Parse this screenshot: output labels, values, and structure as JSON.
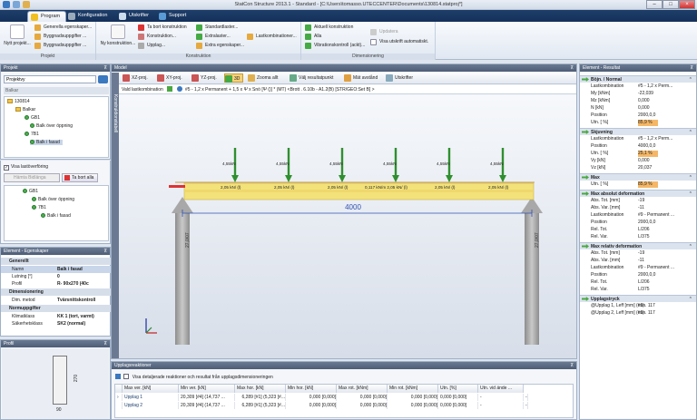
{
  "window": {
    "title": "StatCon Structure 2013.1 - Standard - [C:\\Users\\tomasso.UTECCENTER\\Documents\\130814.statproj*]"
  },
  "tabs": [
    {
      "label": "Program"
    },
    {
      "label": "Konfiguration"
    },
    {
      "label": "Utskrifter"
    },
    {
      "label": "Support"
    }
  ],
  "ribbon": {
    "projekt_group": "Projekt",
    "new_project": "Nytt projekt...",
    "gen_props": "Generella egenskaper...",
    "building_props": "Byggnadsuppgifter ...",
    "building_props2": "Byggnadsuppgifter ...",
    "new_construction": "Ny konstruktion...",
    "delete_construction": "Ta bort konstruktion",
    "construction": "Konstruktion...",
    "supports": "Upplag...",
    "standard_sizes": "Standardlaster...",
    "extra_loads": "Extralaster...",
    "extra_props": "Extra egenskaper...",
    "load_combinations": "Lastkombinationer...",
    "konstruktion_group": "Konstruktion",
    "current_construction": "Aktuell konstruktion",
    "all": "Alla",
    "vibration_check": "Vibrationskontroll (ackt)...",
    "dimensionering_group": "Dimensionering",
    "update": "Updatera",
    "show_print_auto": "Visa utskrift automatiskt."
  },
  "project": {
    "header": "Projekt",
    "view_select": "Projektvy",
    "tree_title": "Balkar",
    "tree": [
      "130814",
      "Balkar",
      "GB1",
      "Balk över öppning",
      "7B1",
      "Balk i fasad"
    ]
  },
  "loadflow": {
    "checkbox_label": "Visa lastöverföring",
    "btn_add": "Hämta Bidlänga",
    "btn_remove": "Ta bort alla",
    "tree": [
      "GB1",
      "Balk över öppning",
      "7B1",
      "Balk i fasad"
    ]
  },
  "element_props": {
    "header": "Element - Egenskaper",
    "sections": {
      "general": "Generellt",
      "dim": "Dimensionering",
      "norm": "Normuppgifter"
    },
    "rows": [
      {
        "k": "Namn",
        "v": "Balk i fasad"
      },
      {
        "k": "Lutning [°]",
        "v": "0"
      },
      {
        "k": "Profil",
        "v": "R- 90x270 (40c"
      },
      {
        "k": "Dim. metod",
        "v": "Tvärsnittskontroll"
      },
      {
        "k": "Klimatklass",
        "v": "KK 1 (tort, varmt)"
      },
      {
        "k": "Säkerhetsklass",
        "v": "SK2 (normal)"
      }
    ]
  },
  "profile": {
    "header": "Profil",
    "height": "270",
    "width": "90"
  },
  "model": {
    "header": "Model",
    "side_tab": "Konstruktionstabell",
    "toolbar": [
      {
        "label": "XZ-proj."
      },
      {
        "label": "XY-proj."
      },
      {
        "label": "YZ-proj."
      },
      {
        "label": "3D"
      },
      {
        "label": "Zooma allt"
      },
      {
        "label": "Välj resultatpunkt"
      },
      {
        "label": "Mät avstånd"
      },
      {
        "label": "Utskrifter"
      }
    ],
    "loadcomb_label": "Vald lastkombination",
    "loadcomb_value": "#5 - 1,2 x Permanent + 1,5 x Ψ x Snö [Ψ ()] *   (MT)   <Brott . 6.10b - A1.2(B) [STR/GEO:Set B] >",
    "span": "4000",
    "support_height": "27,0/07",
    "point_loads": [
      "4,55kN",
      "4,55kN",
      "4,55kN",
      "4,55kN",
      "4,55kN",
      "4,55kN"
    ],
    "dist_loads": [
      "2,05 kN/ (l)",
      "2,05 kN/ (l)",
      "2,05 kN/ (l)",
      "0,117 kN/m 2,05 kN/ (l)",
      "2,05 kN/ (l)",
      "2,05 kN/ (l)"
    ]
  },
  "reactions": {
    "header": "Upplagsreaktioner",
    "checkbox_label": "Visa detaljerade reaktioner och resultat från upplagsdimensioneringen",
    "columns": [
      "",
      "Max ver. [kN]",
      "Min ver. [kN]",
      "Max hor. [kN]",
      "Min hor. [kN]",
      "Max rot. [kNm]",
      "Min rot. [kNm]",
      "Utn. [%]",
      "Utn. vid ände ..."
    ],
    "rows": [
      [
        "Upplag 1",
        "20,309 [#4] (14,737 ...",
        "6,289 [#1] (5,323 [#...",
        "0,000 [0,000]",
        "0,000 [0,000]",
        "0,000 [0,000]",
        "0,000 [0,000]",
        "-",
        "-"
      ],
      [
        "Upplag 2",
        "20,309 [#4] (14,737 ...",
        "6,289 [#1] (5,323 [#...",
        "0,000 [0,000]",
        "0,000 [0,000]",
        "0,000 [0,000]",
        "0,000 [0,000]",
        "-",
        "-"
      ]
    ]
  },
  "results": {
    "header": "Element - Resultat",
    "sections": [
      {
        "title": "Böjn. / Normal",
        "rows": [
          {
            "k": "Lastkombination",
            "v": "#5 - 1,2 x Perm..."
          },
          {
            "k": "My [kNm]",
            "v": "-22,039"
          },
          {
            "k": "Mz [kNm]",
            "v": "0,000"
          },
          {
            "k": "N [kN]",
            "v": "0,000"
          },
          {
            "k": "Position",
            "v": "2000,0,0"
          },
          {
            "k": "Utn. [ %]",
            "v": "85,9 %",
            "hl": true
          }
        ]
      },
      {
        "title": "Skjuvning",
        "rows": [
          {
            "k": "Lastkombination",
            "v": "#5 - 1,2 x Perm..."
          },
          {
            "k": "Position",
            "v": "4000,0,0"
          },
          {
            "k": "Utn. [ %]",
            "v": "25,1 %",
            "hl": true
          },
          {
            "k": "Vy [kN]",
            "v": "0,000"
          },
          {
            "k": "Vz [kN]",
            "v": "20,037"
          }
        ]
      },
      {
        "title": "Max",
        "rows": [
          {
            "k": "Utn. [ %]",
            "v": "85,9 %",
            "hl": true
          }
        ]
      },
      {
        "title": "Max absolut deformation",
        "rows": [
          {
            "k": "Abs. Tot. [mm]",
            "v": "-19"
          },
          {
            "k": "Abs. Var. [mm]",
            "v": "-11"
          },
          {
            "k": "Lastkombination",
            "v": "#9 - Permanent ..."
          },
          {
            "k": "Position",
            "v": "2000,0,0"
          },
          {
            "k": "Rel. Tot.",
            "v": "L/206"
          },
          {
            "k": "Rel. Var.",
            "v": "L/375"
          }
        ]
      },
      {
        "title": "Max relativ deformation",
        "rows": [
          {
            "k": "Abs. Tot. [mm]",
            "v": "-19"
          },
          {
            "k": "Abs. Var. [mm]",
            "v": "-11"
          },
          {
            "k": "Lastkombination",
            "v": "#9 - Permanent ..."
          },
          {
            "k": "Position",
            "v": "2000,0,0"
          },
          {
            "k": "Rel. Tot.",
            "v": "L/206"
          },
          {
            "k": "Rel. Var.",
            "v": "L/375"
          }
        ]
      },
      {
        "title": "Upplagstryck",
        "rows": [
          {
            "k": "@Upplag 1, Leff [mm] (#1)",
            "v": "min. 117"
          },
          {
            "k": "@Upplag 2, Leff [mm] (#1)",
            "v": "min. 117"
          }
        ]
      }
    ]
  },
  "colors": {
    "accent": "#1e3f6a",
    "highlight": "#f5b767",
    "beam": "#f3e27a",
    "load": "#2f8f2f"
  }
}
